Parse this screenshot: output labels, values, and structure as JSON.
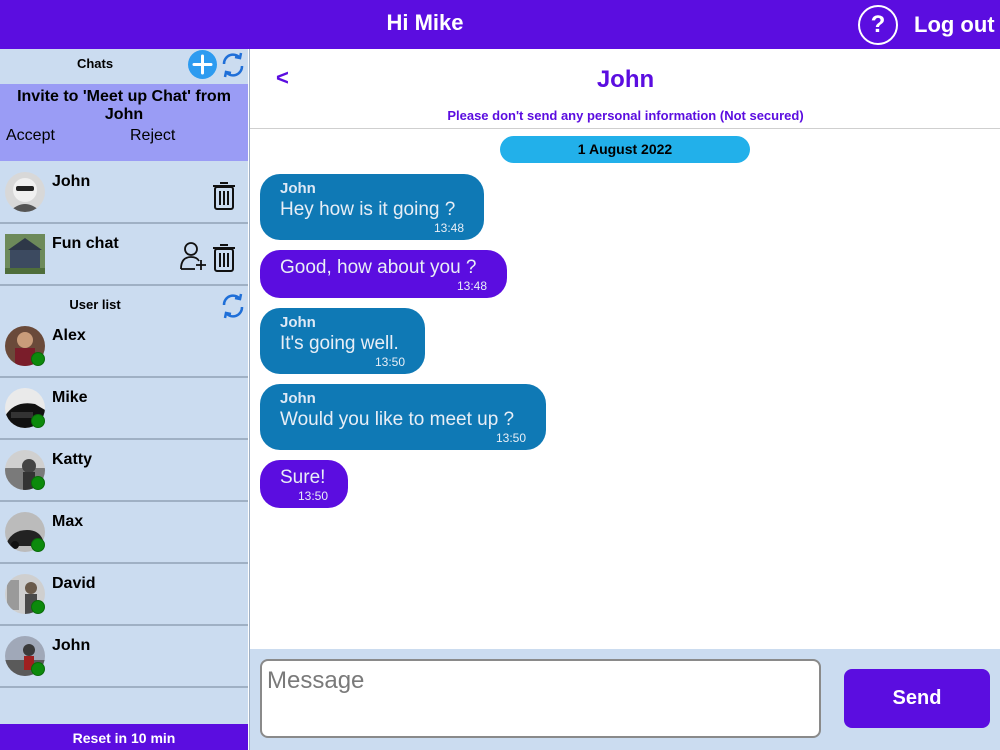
{
  "header": {
    "greeting": "Hi Mike",
    "help_label": "?",
    "logout_label": "Log out"
  },
  "sidebar": {
    "chats_title": "Chats",
    "invite": {
      "text": "Invite to 'Meet up Chat' from John",
      "accept_label": "Accept",
      "reject_label": "Reject"
    },
    "chats": [
      {
        "name": "John",
        "icons": [
          "trash-icon"
        ]
      },
      {
        "name": "Fun chat",
        "icons": [
          "add-user-icon",
          "trash-icon"
        ]
      }
    ],
    "userlist_title": "User list",
    "users": [
      {
        "name": "Alex",
        "status": "online"
      },
      {
        "name": "Mike",
        "status": "online"
      },
      {
        "name": "Katty",
        "status": "online"
      },
      {
        "name": "Max",
        "status": "online"
      },
      {
        "name": "David",
        "status": "online"
      },
      {
        "name": "John",
        "status": "online"
      }
    ],
    "reset_text": "Reset in 10 min"
  },
  "chat": {
    "back_label": "<",
    "title": "John",
    "warning": "Please don't send any personal information (Not secured)",
    "date": "1 August 2022",
    "messages": [
      {
        "sender": "John",
        "text": "Hey how is it going ?",
        "time": "13:48",
        "direction": "in"
      },
      {
        "sender": "",
        "text": "Good, how about you ?",
        "time": "13:48",
        "direction": "out"
      },
      {
        "sender": "John",
        "text": "It's going well.",
        "time": "13:50",
        "direction": "in"
      },
      {
        "sender": "John",
        "text": "Would you like to meet up ?",
        "time": "13:50",
        "direction": "in"
      },
      {
        "sender": "",
        "text": "Sure!",
        "time": "13:50",
        "direction": "out"
      }
    ]
  },
  "composer": {
    "placeholder": "Message",
    "value": "",
    "send_label": "Send"
  },
  "colors": {
    "brand": "#5b0de0",
    "sidebar_bg": "#cbdcf0",
    "incoming_bubble": "#0f79b5",
    "date_pill": "#22b0ea",
    "online": "#0c8a0c",
    "add_button": "#2d9bf0"
  }
}
